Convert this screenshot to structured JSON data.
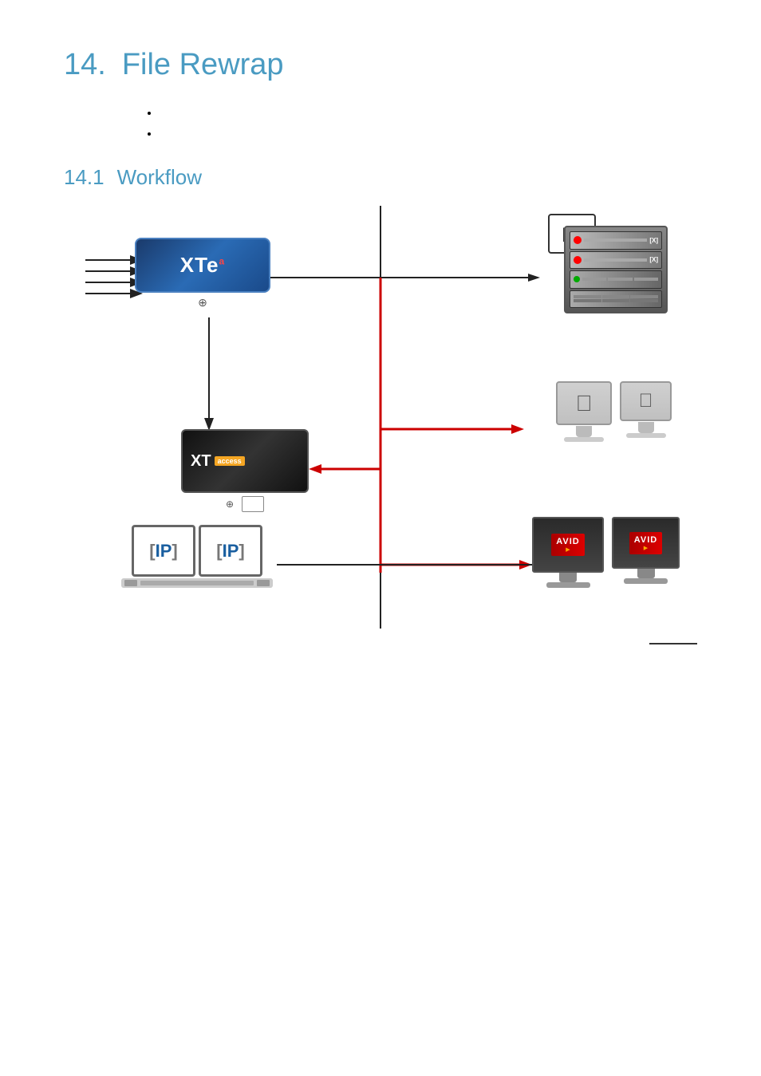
{
  "page": {
    "heading_1_number": "14.",
    "heading_1_text": "File Rewrap",
    "heading_2_number": "14.1",
    "heading_2_text": "Workflow",
    "bullets": [
      "",
      ""
    ],
    "page_number": ""
  },
  "diagram": {
    "xte_label": "XTe",
    "xte_sup": "a",
    "xt_access_label": "XT",
    "xt_access_badge": "access",
    "ip_label": "IP",
    "server_top_label": "[X]",
    "avid_label": "AVID",
    "mac_symbol": ""
  },
  "colors": {
    "heading_blue": "#4a9bc2",
    "xte_bg": "#1a5099",
    "black_line": "#222222",
    "red_line": "#cc0000"
  }
}
